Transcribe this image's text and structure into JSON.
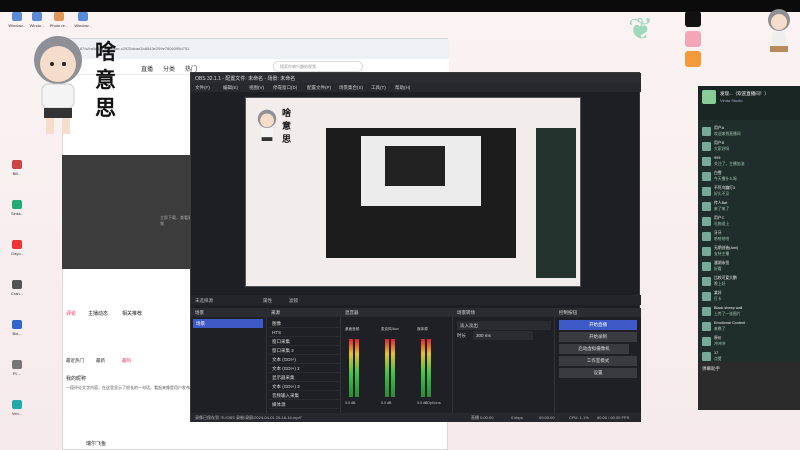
{
  "desktop": {
    "top_icons": [
      "Window...",
      "Windo...",
      "Photo re...",
      "Window...",
      "Wind..."
    ],
    "left_icons": [
      "Bill...",
      "Sinks..",
      "Dayo..",
      "Cran...",
      "Bol...",
      "PL...",
      "Ven..."
    ],
    "mascot_text": [
      "啥",
      "意",
      "思"
    ]
  },
  "browser": {
    "url": "11b5187/s/ba5e1c19d04bae-c2925dcad1b8843e299e7806095d751",
    "nav_items": [
      "直播",
      "分类",
      "热门"
    ],
    "search_placeholder": "搜索你感兴趣的视频",
    "dark_panel_text": "立即下载，查看更多视频",
    "tabs": [
      "评论",
      "主播动态",
      "相关推荐"
    ],
    "sort_labels": [
      "最近热门",
      "最新",
      "最热"
    ],
    "comment_user": "我的昵称",
    "comment_text": "一段评论文字内容，在这里显示了很长的一句话，看起来像是用户发布的消息内容...",
    "bottom_user": "瑞尔飞鱼"
  },
  "obs": {
    "title": "OBS 32.1.1 - 配置文件: 未命名 - 场景: 未命名",
    "menu": [
      "文件(F)",
      "编辑(E)",
      "视图(V)",
      "停靠窗口(D)",
      "配置文件(P)",
      "场景集合(S)",
      "工具(T)",
      "帮助(H)"
    ],
    "preview_text": [
      "啥",
      "意",
      "思"
    ],
    "toolbar_left": "未选择源",
    "toolbar_buttons": [
      "属性",
      "滤镜"
    ],
    "docks": [
      "场景",
      "来源",
      "混音器",
      "场景转场",
      "控制按钮"
    ],
    "scenes": [
      "场景"
    ],
    "sources": [
      "图像",
      "HTS",
      "窗口采集",
      "窗口采集 2",
      "文本 (GDI+)",
      "文本 (GDI+) 2",
      "显示器采集",
      "文本 (GDI+) 3",
      "音频输入采集",
      "媒体源"
    ],
    "mixer_channels": [
      {
        "name": "桌面音频",
        "db": "0.0 dB"
      },
      {
        "name": "麦克风/Aux",
        "db": "0.0 dB"
      },
      {
        "name": "媒体源",
        "db": "0.0 dB"
      }
    ],
    "transition": {
      "type": "淡入淡出",
      "duration_label": "时长",
      "duration": "300 ms"
    },
    "controls": [
      "开始直播",
      "开始录制",
      "启动虚拟摄像机",
      "工作室模式",
      "设置"
    ],
    "status": {
      "recording_path": "录像已保存到 \"E:/OBS 录制/录屏/2024-04-01 20-16-14.mp4\"",
      "live": "直播 0:00:00",
      "kbps": "0 kbps",
      "rec": "00:00:00",
      "cpu": "CPU: 1.1%",
      "fps": "60.00 / 60.00 FPS"
    },
    "options_label": "Options"
  },
  "chat": {
    "title": "发现...（欢迎直播间！）",
    "subtitle": "Vinda Studio",
    "messages": [
      {
        "name": "用户A",
        "text": "欢迎来到直播间"
      },
      {
        "name": "用户B",
        "text": "大家好呀"
      },
      {
        "name": "999",
        "text": "关注了，主播加油"
      },
      {
        "name": "白雪",
        "text": "今天播什么呀"
      },
      {
        "name": "不死鸟蹦打3",
        "text": "好久不见"
      },
      {
        "name": "传人Bat",
        "text": "来了来了"
      },
      {
        "name": "用户C",
        "text": "礼物送上"
      },
      {
        "name": "牙牙",
        "text": "哈哈哈哈"
      },
      {
        "name": "无期创造(Ami)",
        "text": "支持主播"
      },
      {
        "name": "潘湖永恒",
        "text": "好看"
      },
      {
        "name": "比较可爱大鹏",
        "text": "晚上好"
      },
      {
        "name": "某好",
        "text": "打卡"
      },
      {
        "name": "Black sheep wall",
        "text": "上传了一张图片"
      },
      {
        "name": "Emotional Content",
        "text": "来晚了"
      },
      {
        "name": "原价",
        "text": "冲冲冲"
      },
      {
        "name": "17",
        "text": "点赞"
      }
    ],
    "secondary_title": "弹幕助手"
  }
}
